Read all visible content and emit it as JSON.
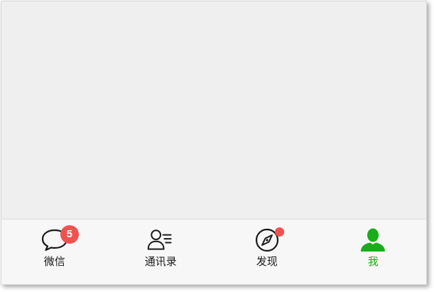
{
  "tabbar": {
    "tabs": [
      {
        "label": "微信",
        "icon": "chat-bubble-icon",
        "badge": "5"
      },
      {
        "label": "通讯录",
        "icon": "contacts-icon"
      },
      {
        "label": "发现",
        "icon": "compass-icon",
        "dot": true
      },
      {
        "label": "我",
        "icon": "person-icon",
        "active": true
      }
    ]
  },
  "colors": {
    "accent": "#1aad19",
    "badge": "#f0524f",
    "background": "#efefef",
    "tabbar_bg": "#f7f7f7"
  }
}
